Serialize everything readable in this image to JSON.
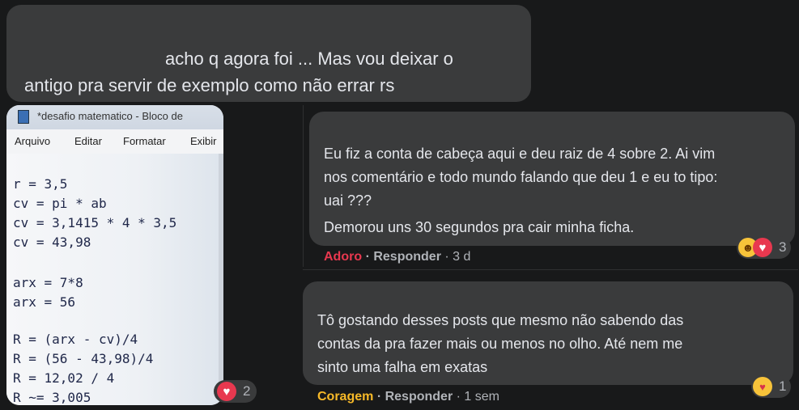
{
  "top_comment": {
    "line1": "acho q agora foi ... Mas vou deixar o",
    "line2": "antigo pra servir de exemplo como não errar rs"
  },
  "photo": {
    "window_title": "*desafio matematico - Bloco de",
    "menu": [
      "Arquivo",
      "Editar",
      "Formatar",
      "Exibir"
    ],
    "lines": [
      "r = 3,5",
      "cv = pi * ab",
      "cv = 3,1415 * 4 * 3,5",
      "cv = 43,98",
      "",
      "arx = 7*8",
      "arx = 56",
      "",
      "R = (arx - cv)/4",
      "R = (56 - 43,98)/4",
      "R = 12,02 / 4",
      "R ~= 3,005"
    ],
    "reaction_count": "2"
  },
  "comment1": {
    "lines": [
      "Eu fiz a conta de cabeça aqui e deu raiz de 4 sobre 2. Ai vim",
      "nos comentário e todo mundo falando que deu 1 e eu to tipo:",
      "uai ???",
      "Demorou uns 30 segundos pra cair minha ficha."
    ],
    "reaction_label": "Adoro",
    "reply_label": "Responder",
    "time": "3 d",
    "reaction_count": "3"
  },
  "comment2": {
    "lines": [
      "Tô gostando desses posts que mesmo não sabendo das",
      "contas da pra fazer mais ou menos no olho. Até nem me",
      "sinto uma falha em exatas"
    ],
    "reaction_label": "Coragem",
    "reply_label": "Responder",
    "time": "1 sem",
    "reaction_count": "1"
  },
  "icons": {
    "heart": "heart-reaction-icon",
    "laugh": "laugh-reaction-icon",
    "care": "care-reaction-icon"
  },
  "colors": {
    "background": "#18191a",
    "bubble": "#3a3b3c",
    "adoro": "#e8384f",
    "coragem": "#f7b928"
  }
}
